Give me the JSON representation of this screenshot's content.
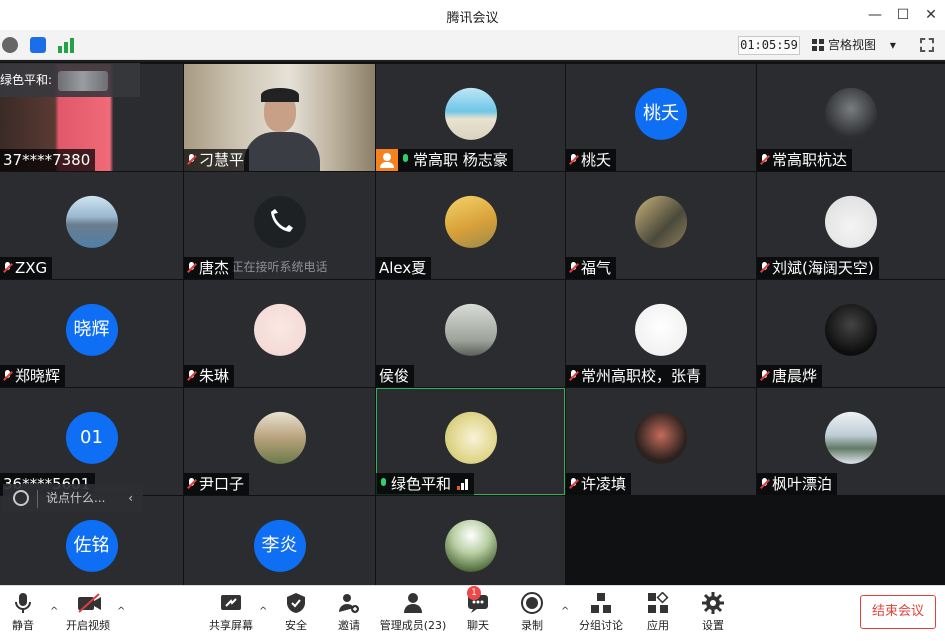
{
  "window": {
    "title": "腾讯会议",
    "min": "—",
    "max": "☐",
    "close": "✕"
  },
  "toolbar": {
    "timer": "01:05:59",
    "view_label": "宫格视图",
    "view_caret": "▾"
  },
  "speaking": {
    "label": "绿色平和:"
  },
  "tiles": [
    {
      "name": "37****7380",
      "mic": "none",
      "avatar": "photo"
    },
    {
      "name": "刁慧平",
      "mic": "muted",
      "avatar": "camera"
    },
    {
      "name": "常高职  杨志豪",
      "mic": "live",
      "avatar": "beach",
      "host": true
    },
    {
      "name": "桃夭",
      "mic": "muted",
      "avatar_text": "桃夭"
    },
    {
      "name": "常高职杭达",
      "mic": "muted",
      "avatar": "dark"
    },
    {
      "name": "ZXG",
      "mic": "muted",
      "avatar": "cliff"
    },
    {
      "name": "唐杰",
      "mic": "muted",
      "avatar": "phone",
      "note": "正在接听系统电话"
    },
    {
      "name": "Alex夏",
      "mic": "none",
      "avatar": "field"
    },
    {
      "name": "福气",
      "mic": "muted",
      "avatar": "rail"
    },
    {
      "name": "刘斌(海阔天空)",
      "mic": "muted",
      "avatar": "bike"
    },
    {
      "name": "郑晓辉",
      "mic": "muted",
      "avatar_text": "晓辉"
    },
    {
      "name": "朱琳",
      "mic": "muted",
      "avatar": "girl"
    },
    {
      "name": "侯俊",
      "mic": "none",
      "avatar": "family"
    },
    {
      "name": "常州高职校，张青",
      "mic": "muted",
      "avatar": "cartoon"
    },
    {
      "name": "唐晨烨",
      "mic": "muted",
      "avatar": "mamba"
    },
    {
      "name": "36****5601",
      "mic": "none",
      "avatar_text": "01"
    },
    {
      "name": "尹口子",
      "mic": "muted",
      "avatar": "tree"
    },
    {
      "name": "绿色平和",
      "mic": "live",
      "avatar": "flowers",
      "active": true
    },
    {
      "name": "许凌填",
      "mic": "muted",
      "avatar": "woman"
    },
    {
      "name": "枫叶漂泊",
      "mic": "muted",
      "avatar": "lake"
    },
    {
      "name": "",
      "mic": "none",
      "avatar_text": "佐铭"
    },
    {
      "name": "",
      "mic": "none",
      "avatar_text": "李炎"
    },
    {
      "name": "",
      "mic": "none",
      "avatar": "forest"
    }
  ],
  "chat": {
    "placeholder": "说点什么...",
    "collapse": "‹"
  },
  "bottombar": {
    "mute": "静音",
    "video": "开启视频",
    "share": "共享屏幕",
    "security": "安全",
    "invite": "邀请",
    "members": "管理成员(23)",
    "chat": "聊天",
    "chat_badge": "1",
    "record": "录制",
    "breakout": "分组讨论",
    "apps": "应用",
    "settings": "设置",
    "end": "结束会议",
    "caret": "^"
  },
  "colors": {
    "avatar_blue": "#0e6ef4",
    "active_border": "#2fb35a",
    "end_red": "#e3433b",
    "host_orange": "#f5821f"
  }
}
